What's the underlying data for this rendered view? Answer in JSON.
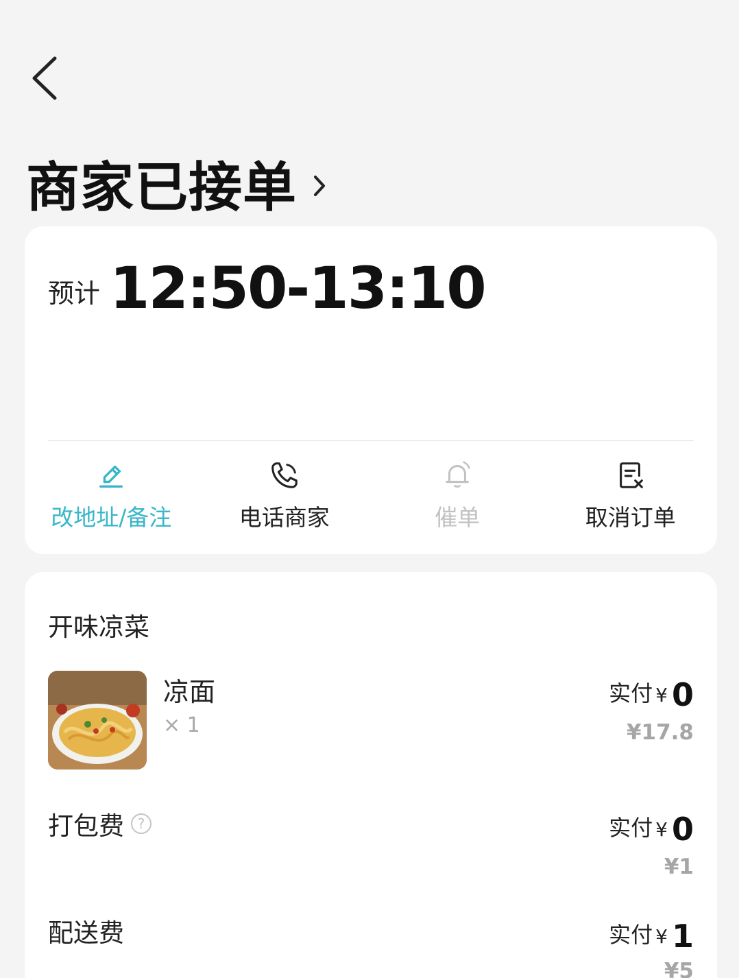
{
  "header": {
    "status_title": "商家已接单"
  },
  "eta": {
    "prefix": "预计",
    "time_range": "12:50-13:10"
  },
  "actions": [
    {
      "label": "改地址/备注",
      "icon": "edit-icon",
      "state": "active"
    },
    {
      "label": "电话商家",
      "icon": "phone-icon",
      "state": "normal"
    },
    {
      "label": "催单",
      "icon": "bell-icon",
      "state": "disabled"
    },
    {
      "label": "取消订单",
      "icon": "cancel-order-icon",
      "state": "normal"
    }
  ],
  "colors": {
    "accent": "#38b6c9",
    "disabled": "#c2c2c2",
    "background": "#f4f4f4"
  },
  "order": {
    "shop_name": "开味凉菜",
    "items": [
      {
        "name": "凉面",
        "quantity": "× 1",
        "paid_label": "实付",
        "currency": "¥",
        "paid_value": "0",
        "original_price": "¥17.8"
      }
    ],
    "fees": [
      {
        "label": "打包费",
        "has_help": true,
        "help_symbol": "?",
        "paid_label": "实付",
        "currency": "¥",
        "paid_value": "0",
        "original_price": "¥1"
      },
      {
        "label": "配送费",
        "has_help": false,
        "paid_label": "实付",
        "currency": "¥",
        "paid_value": "1",
        "original_price": "¥5"
      }
    ]
  }
}
